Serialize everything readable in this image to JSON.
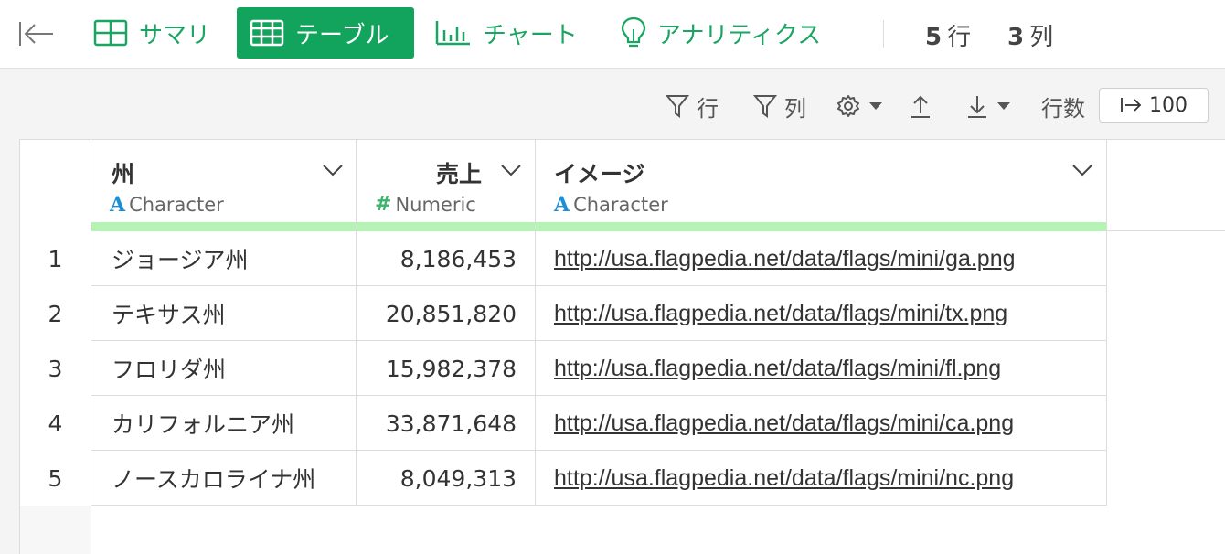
{
  "toolbar": {
    "tabs": [
      {
        "label": "サマリ",
        "icon": "grid-icon"
      },
      {
        "label": "テーブル",
        "icon": "table-icon",
        "active": true
      },
      {
        "label": "チャート",
        "icon": "bar-chart-icon"
      },
      {
        "label": "アナリティクス",
        "icon": "lightbulb-icon"
      }
    ],
    "row_count": "5",
    "row_unit": "行",
    "col_count": "3",
    "col_unit": "列",
    "accent_color": "#12a45c"
  },
  "actions": {
    "filter_rows_label": "行",
    "filter_cols_label": "列",
    "rows_label": "行数",
    "rows_value": "100"
  },
  "table": {
    "columns": [
      {
        "name": "州",
        "type": "Character"
      },
      {
        "name": "売上",
        "type": "Numeric"
      },
      {
        "name": "イメージ",
        "type": "Character"
      }
    ],
    "rows": [
      {
        "num": "1",
        "state": "ジョージア州",
        "sales": "8,186,453",
        "image": "http://usa.flagpedia.net/data/flags/mini/ga.png"
      },
      {
        "num": "2",
        "state": "テキサス州",
        "sales": "20,851,820",
        "image": "http://usa.flagpedia.net/data/flags/mini/tx.png"
      },
      {
        "num": "3",
        "state": "フロリダ州",
        "sales": "15,982,378",
        "image": "http://usa.flagpedia.net/data/flags/mini/fl.png"
      },
      {
        "num": "4",
        "state": "カリフォルニア州",
        "sales": "33,871,648",
        "image": "http://usa.flagpedia.net/data/flags/mini/ca.png"
      },
      {
        "num": "5",
        "state": "ノースカロライナ州",
        "sales": "8,049,313",
        "image": "http://usa.flagpedia.net/data/flags/mini/nc.png"
      }
    ]
  }
}
